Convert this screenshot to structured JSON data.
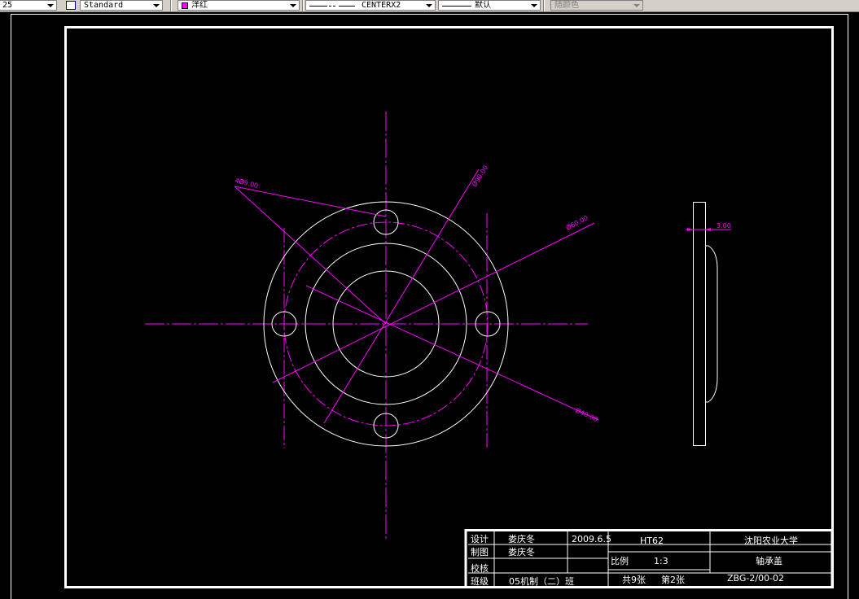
{
  "toolbar": {
    "lineweight_value": "25",
    "textstyle_value": "Standard",
    "color_value": "洋红",
    "color_hex": "#ff00ff",
    "linetype_value": "CENTERX2",
    "lineweight2_value": "默认",
    "plotstyle_value": "随颜色"
  },
  "dimensions": {
    "hole_dia": "4Ø9.00",
    "pitch_dia": "Ø90.00",
    "outer_dia": "Ø60.00",
    "inner_dia": "Ø40.00",
    "thickness": "3.00"
  },
  "title_block": {
    "designer_label": "设计",
    "designer_name": "娄庆冬",
    "date": "2009.6.5",
    "drafter_label": "制图",
    "drafter_name": "娄庆冬",
    "material": "HT62",
    "school": "沈阳农业大学",
    "checker_label": "校核",
    "scale_label": "比例",
    "scale_value": "1:3",
    "part_name": "轴承盖",
    "class_label": "班级",
    "class_value": "05机制（二）班",
    "total_sheets": "共9张",
    "sheet_no": "第2张",
    "drawing_no": "ZBG-2/00-02"
  }
}
